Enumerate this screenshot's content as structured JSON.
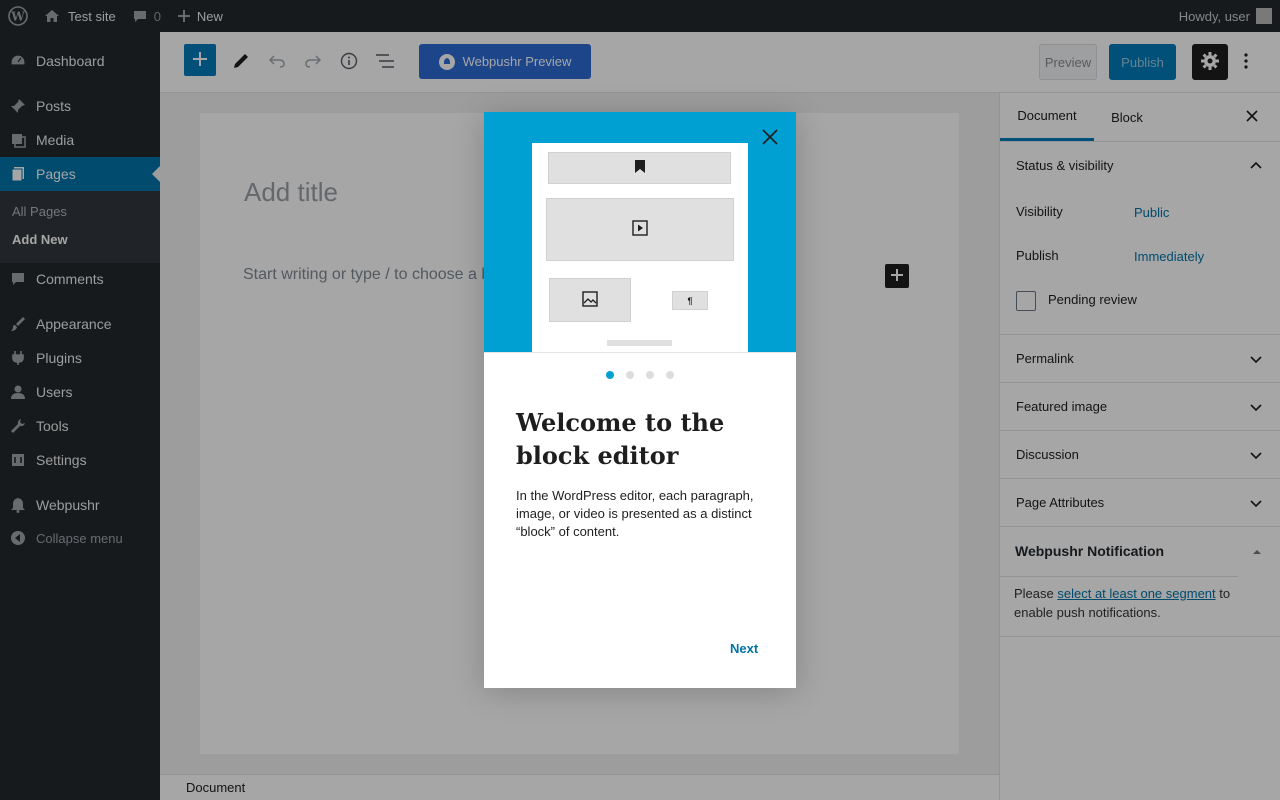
{
  "adminbar": {
    "site_name": "Test site",
    "comments_count": "0",
    "new_label": "New",
    "greeting": "Howdy, user"
  },
  "admin_menu": {
    "items": [
      {
        "label": "Dashboard",
        "icon": "dashboard-icon"
      },
      {
        "label": "Posts",
        "icon": "pin-icon"
      },
      {
        "label": "Media",
        "icon": "media-icon"
      },
      {
        "label": "Pages",
        "icon": "pages-icon"
      },
      {
        "label": "Comments",
        "icon": "comment-icon"
      },
      {
        "label": "Appearance",
        "icon": "brush-icon"
      },
      {
        "label": "Plugins",
        "icon": "plugin-icon"
      },
      {
        "label": "Users",
        "icon": "users-icon"
      },
      {
        "label": "Tools",
        "icon": "wrench-icon"
      },
      {
        "label": "Settings",
        "icon": "settings-icon"
      },
      {
        "label": "Webpushr",
        "icon": "bell-icon"
      }
    ],
    "submenu": [
      "All Pages",
      "Add New"
    ],
    "collapse_label": "Collapse menu"
  },
  "editor_header": {
    "webpushr_preview_label": "Webpushr Preview",
    "preview_label": "Preview",
    "publish_label": "Publish"
  },
  "canvas": {
    "title_placeholder": "Add title",
    "body_placeholder": "Start writing or type / to choose a block"
  },
  "sidebar": {
    "tabs": [
      "Document",
      "Block"
    ],
    "status_panel": {
      "title": "Status & visibility",
      "visibility_label": "Visibility",
      "visibility_value": "Public",
      "publish_label": "Publish",
      "publish_value": "Immediately",
      "pending_review_label": "Pending review"
    },
    "panels": [
      "Permalink",
      "Featured image",
      "Discussion",
      "Page Attributes"
    ],
    "webpushr": {
      "title": "Webpushr Notification",
      "note_prefix": "Please ",
      "note_link": "select at least one segment",
      "note_suffix": " to enable push notifications."
    }
  },
  "footer": {
    "breadcrumb": "Document"
  },
  "modal": {
    "heading": "Welcome to the block editor",
    "text": "In the WordPress editor, each paragraph, image, or video is presented as a distinct “block” of content.",
    "next_label": "Next",
    "page_count": 4,
    "current_page": 1,
    "hero_color": "#00a0d2"
  },
  "colors": {
    "admin_dark": "#23282d",
    "accent": "#007cba",
    "webpushr_button": "#2b6ad4"
  }
}
